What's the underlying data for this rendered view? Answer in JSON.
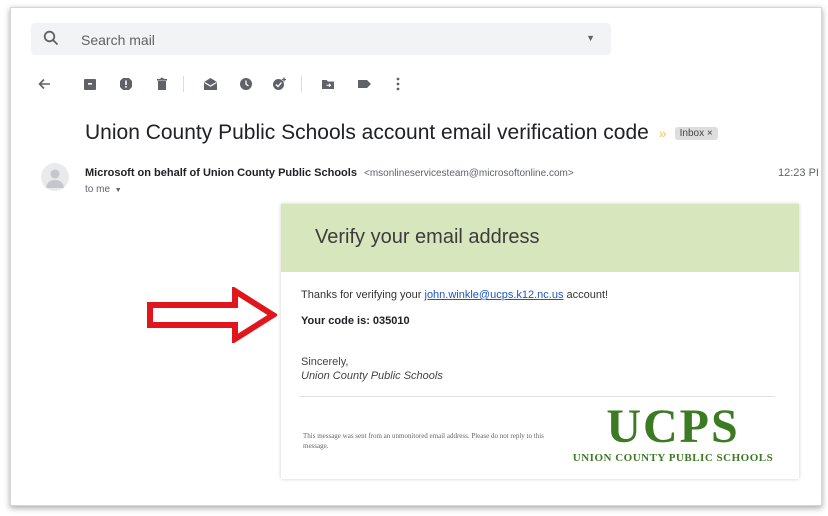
{
  "search": {
    "placeholder": "Search mail"
  },
  "toolbar": {
    "icons": [
      "back-icon",
      "archive-icon",
      "report-spam-icon",
      "delete-icon",
      "mark-unread-icon",
      "snooze-icon",
      "add-to-tasks-icon",
      "move-to-icon",
      "labels-icon",
      "more-icon"
    ]
  },
  "email": {
    "subject": "Union County Public Schools account email verification code",
    "label": "Inbox",
    "sender_name": "Microsoft on behalf of Union County Public Schools",
    "sender_email": "<msonlineservicesteam@microsoftonline.com>",
    "time": "12:23 PI",
    "to": "to me"
  },
  "body": {
    "heading": "Verify your email address",
    "thanks_prefix": "Thanks for verifying your ",
    "account_email": "john.winkle@ucps.k12.nc.us",
    "thanks_suffix": " account!",
    "code_line": "Your code is: 035010",
    "sincerely": "Sincerely,",
    "org_name": "Union County Public Schools",
    "footer": "This message was sent from an unmonitored email address. Please do not reply to this message."
  },
  "logo": {
    "word": "UCPS",
    "tagline": "UNION COUNTY PUBLIC SCHOOLS"
  },
  "colors": {
    "header_bg": "#d8e6bd",
    "logo_green": "#3d7a24",
    "link": "#1a55c8",
    "arrow_red": "#e0161c"
  }
}
